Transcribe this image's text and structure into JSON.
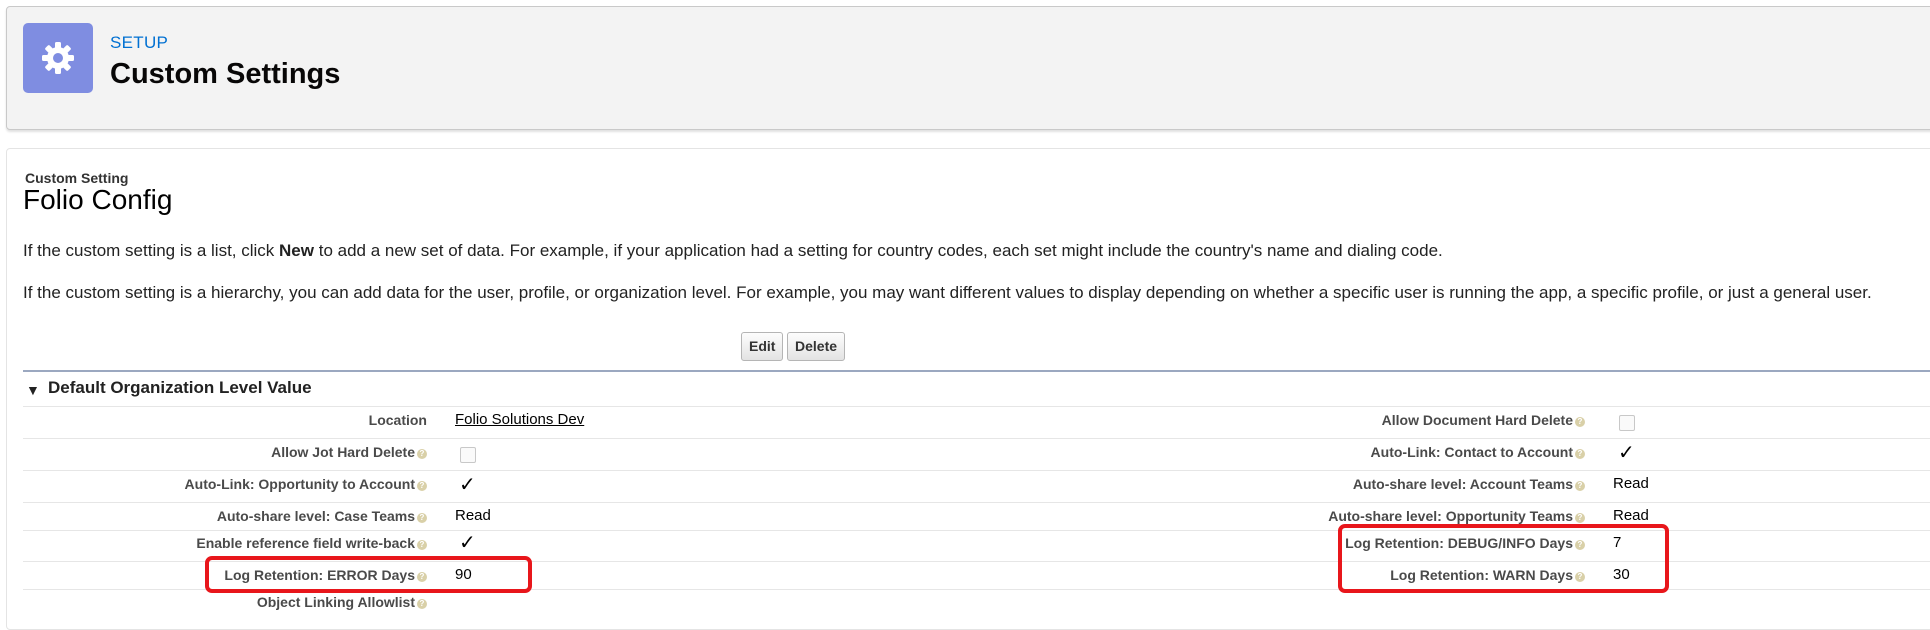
{
  "header": {
    "breadcrumb": "SETUP",
    "title": "Custom Settings",
    "icon": "gear-icon",
    "icon_bg": "#7f8de1"
  },
  "custom_setting": {
    "type_label": "Custom Setting",
    "name": "Folio Config",
    "desc1_pre": "If the custom setting is a list, click ",
    "desc1_bold": "New",
    "desc1_post": " to add a new set of data. For example, if your application had a setting for country codes, each set might include the country's name and dialing code.",
    "desc2": "If the custom setting is a hierarchy, you can add data for the user, profile, or organization level. For example, you may want different values to display depending on whether a specific user is running the app, a specific profile, or just a general user."
  },
  "buttons": {
    "edit": "Edit",
    "delete": "Delete"
  },
  "section": {
    "title": "Default Organization Level Value",
    "left_fields": [
      {
        "label": "Location",
        "value": "Folio Solutions Dev",
        "kind": "link",
        "help": false
      },
      {
        "label": "Allow Jot Hard Delete",
        "kind": "checkbox",
        "checked": false,
        "help": true
      },
      {
        "label": "Auto-Link: Opportunity to Account",
        "kind": "checkbox",
        "checked": true,
        "help": true
      },
      {
        "label": "Auto-share level: Case Teams",
        "value": "Read",
        "kind": "text",
        "help": true
      },
      {
        "label": "Enable reference field write-back",
        "kind": "checkbox",
        "checked": true,
        "help": true
      },
      {
        "label": "Log Retention: ERROR Days",
        "value": "90",
        "kind": "text",
        "help": true
      },
      {
        "label": "Object Linking Allowlist",
        "value": "",
        "kind": "text",
        "help": true
      }
    ],
    "right_fields": [
      {
        "label": "Allow Document Hard Delete",
        "kind": "checkbox",
        "checked": false,
        "help": true
      },
      {
        "label": "Auto-Link: Contact to Account",
        "kind": "checkbox",
        "checked": true,
        "help": true
      },
      {
        "label": "Auto-share level: Account Teams",
        "value": "Read",
        "kind": "text",
        "help": true
      },
      {
        "label": "Auto-share level: Opportunity Teams",
        "value": "Read",
        "kind": "text",
        "help": true
      },
      {
        "label": "Log Retention: DEBUG/INFO Days",
        "value": "7",
        "kind": "text",
        "help": true
      },
      {
        "label": "Log Retention: WARN Days",
        "value": "30",
        "kind": "text",
        "help": true
      }
    ]
  },
  "colors": {
    "link": "#0070d2",
    "highlight": "#e8161b",
    "header_bg": "#f3f3f3"
  }
}
